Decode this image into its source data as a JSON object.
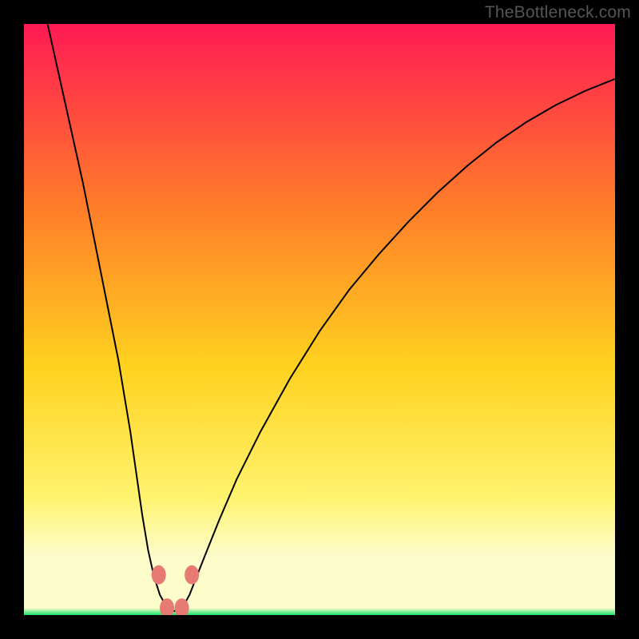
{
  "watermark": "TheBottleneck.com",
  "palette": {
    "bg": "#000000",
    "gradient_top": "#ff1a54",
    "gradient_upper_mid": "#ff7a2a",
    "gradient_mid": "#ffd21f",
    "gradient_lower": "#fff36e",
    "gradient_pale": "#fdfccb",
    "gradient_bottom": "#15e36b",
    "curve": "#000000",
    "marker_fill": "#e77b74",
    "marker_stroke": "#b9534d"
  },
  "chart_data": {
    "type": "line",
    "title": "",
    "xlabel": "",
    "ylabel": "",
    "xlim": [
      0,
      100
    ],
    "ylim": [
      0,
      100
    ],
    "series": [
      {
        "name": "bottleneck-curve",
        "x": [
          4,
          6,
          8,
          10,
          12,
          14,
          16,
          18,
          19,
          20,
          21,
          22,
          23,
          24,
          25,
          26,
          27,
          28,
          30,
          33,
          36,
          40,
          45,
          50,
          55,
          60,
          65,
          70,
          75,
          80,
          85,
          90,
          95,
          100
        ],
        "y": [
          100,
          91,
          82,
          73,
          63,
          53,
          43,
          31,
          24,
          17,
          11,
          6.5,
          3.4,
          1.6,
          0.7,
          0.7,
          1.6,
          3.4,
          8.5,
          16,
          23,
          31,
          40,
          48,
          55,
          61,
          66.5,
          71.5,
          76,
          80,
          83.4,
          86.3,
          88.7,
          90.7
        ]
      }
    ],
    "markers": [
      {
        "x": 22.8,
        "y": 6.8
      },
      {
        "x": 28.4,
        "y": 6.8
      },
      {
        "x": 24.2,
        "y": 1.2
      },
      {
        "x": 26.7,
        "y": 1.2
      }
    ],
    "annotations": []
  }
}
